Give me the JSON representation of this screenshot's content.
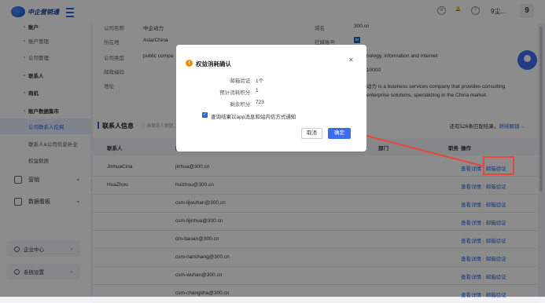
{
  "app": {
    "logo_text": "中企营销通"
  },
  "topbar": {
    "user_label": "9尘...",
    "avatar_text": "9"
  },
  "sidebar": {
    "items": [
      {
        "label": "账户",
        "type": "parent"
      },
      {
        "label": "账户管理",
        "type": "child"
      },
      {
        "label": "公司管理",
        "type": "child"
      },
      {
        "label": "联系人",
        "type": "parent"
      },
      {
        "label": "商机",
        "type": "parent"
      },
      {
        "label": "账户数据集市",
        "type": "parent"
      },
      {
        "label": "公司联系人挖掘",
        "type": "child",
        "active": true
      },
      {
        "label": "联系人&公司信息补全",
        "type": "child"
      },
      {
        "label": "权益数据",
        "type": "child"
      },
      {
        "label": "营销",
        "type": "big"
      },
      {
        "label": "数据看板",
        "type": "big"
      }
    ],
    "bottom": [
      {
        "label": "企业中心"
      },
      {
        "label": "系统设置"
      }
    ]
  },
  "company_info": {
    "name_label": "公司名称",
    "name_value": "中企动力",
    "location_label": "所在地",
    "location_value": "Asia/China",
    "type_label": "公司类型",
    "type_value": "public compa",
    "postcode_label": "邮政编码",
    "address_label": "地址",
    "domain_label": "域名",
    "domain_value": "300.cn",
    "social_label": "社媒账号",
    "social_value": "in",
    "industry_value": "nology, information and internet",
    "employees_value": "10000",
    "desc_line1": "动力 is a business services company that provides consulting",
    "desc_line2": "enterprise solutions, specializing in the China market."
  },
  "contacts_section": {
    "title": "联系人信息",
    "hint": "ⓘ 新联系人数据...",
    "result_prefix": "还有526条匹配结果，",
    "result_link": "继续解锁→"
  },
  "table": {
    "headers": [
      "联系人",
      "邮",
      "部门",
      "职务",
      "操作"
    ],
    "rows": [
      {
        "name": "JinhuaCina",
        "email": "jinhua@300.cn"
      },
      {
        "name": "HuaZhou",
        "email": "huizhou@300.cn"
      },
      {
        "name": "",
        "email": "csm-lijwuhan@300.cn"
      },
      {
        "name": "",
        "email": "csm-lijinhua@300.cn"
      },
      {
        "name": "",
        "email": "dm-baoan@300.cn"
      },
      {
        "name": "",
        "email": "csm-nanchang@300.cn"
      },
      {
        "name": "",
        "email": "csm-wuhan@300.cn"
      },
      {
        "name": "",
        "email": "csm-changsha@300.cn"
      }
    ],
    "op_detail": "查看详情",
    "op_verify": "邮箱验证"
  },
  "modal": {
    "title": "权益消耗确认",
    "items": [
      {
        "label": "邮箱验证:",
        "value": "1个"
      },
      {
        "label": "预计消耗积分:",
        "value": "1"
      },
      {
        "label": "剩余积分:",
        "value": "723"
      }
    ],
    "checkbox_label": "查询结果以app消息和站内信方式通知",
    "checkbox_checked": true,
    "cancel_label": "取消",
    "confirm_label": "确定"
  },
  "colors": {
    "accent": "#3c6df0",
    "annotation": "#e6463c",
    "warning": "#f08c00"
  }
}
